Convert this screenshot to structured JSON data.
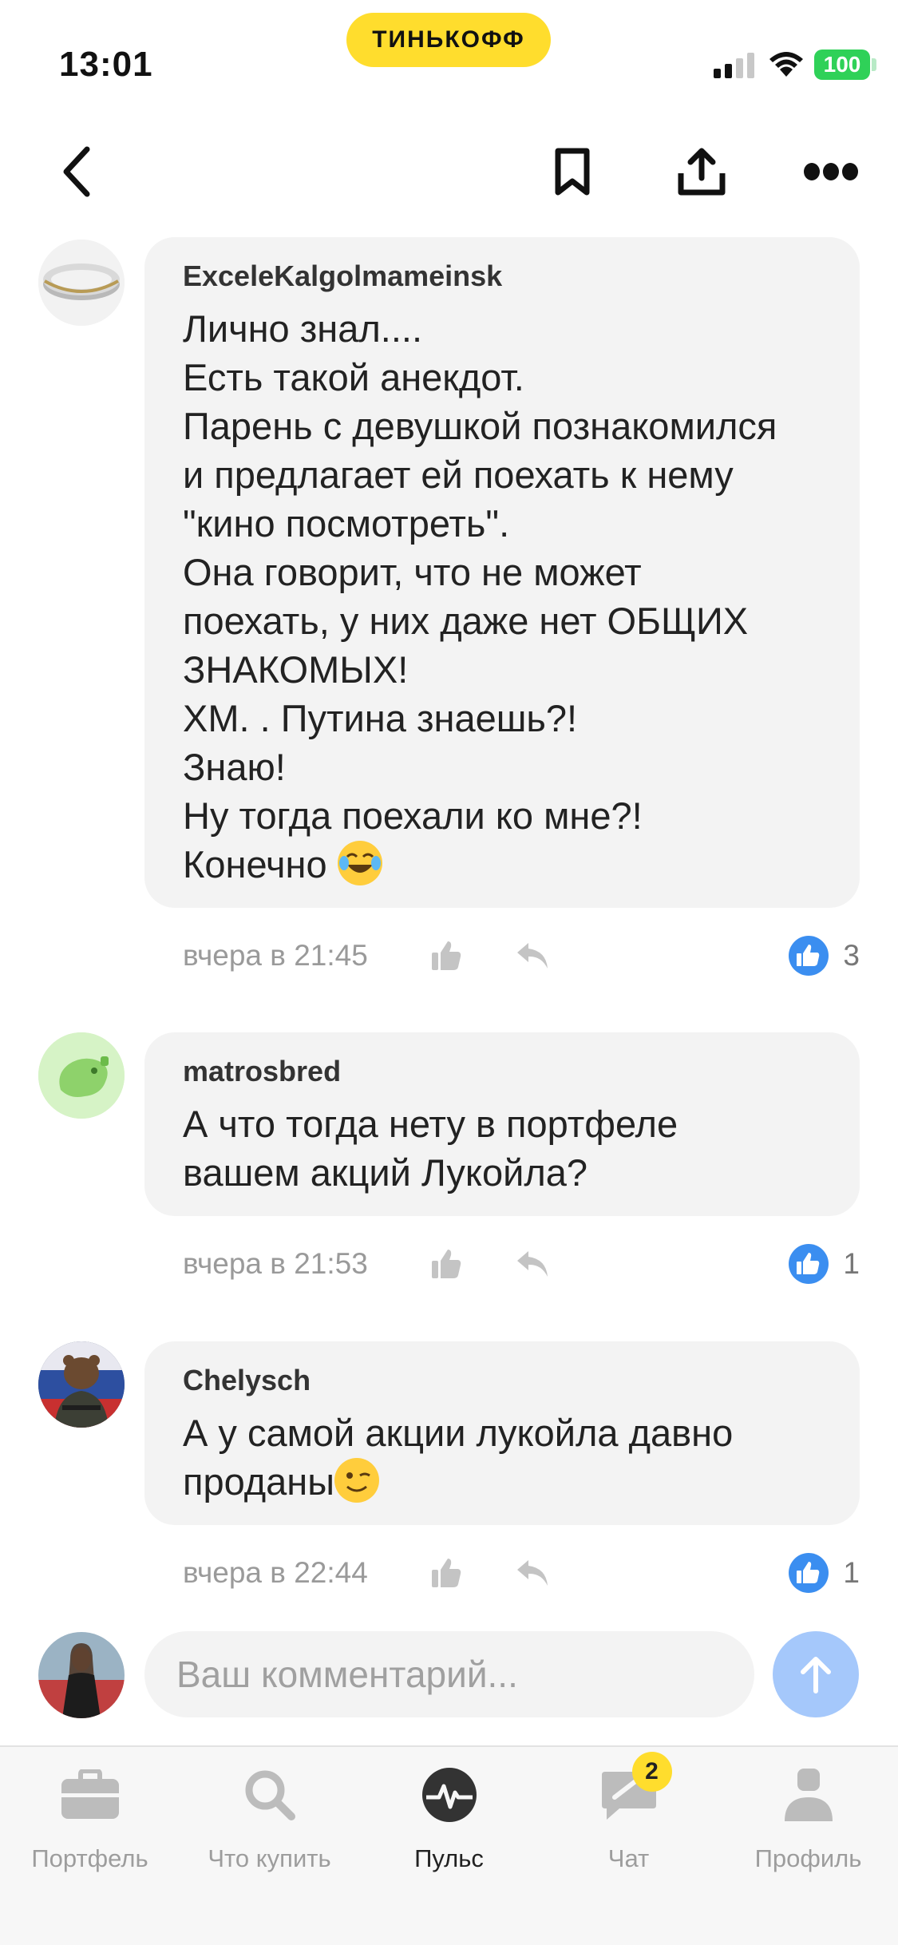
{
  "status_bar": {
    "time": "13:01",
    "brand": "ТИНЬКОФФ",
    "battery": "100",
    "battery_color": "#2fd158"
  },
  "nav": {
    "back_icon": "chevron-left-icon",
    "bookmark_icon": "bookmark-icon",
    "share_icon": "share-icon",
    "more_icon": "more-icon"
  },
  "comments": [
    {
      "author": "ExceleKalgolmameinsk",
      "text": "Лично знал....\nЕсть такой анекдот.\nПарень с девушкой познакомился\nи предлагает ей поехать к нему\n\"кино посмотреть\".\nОна говорит, что не может\nпоехать, у них даже нет ОБЩИХ\nЗНАКОМЫХ!\nХМ. . Путина знаешь?!\nЗнаю!\nНу тогда поехали ко мне?!\nКонечно",
      "emoji": "laughing-tears-emoji",
      "time": "вчера в 21:45",
      "likes": "3",
      "avatar": "ring-avatar"
    },
    {
      "author": "matrosbred",
      "text": "А что тогда нету в портфеле\nвашем акций Лукойла?",
      "emoji": "",
      "time": "вчера в 21:53",
      "likes": "1",
      "avatar": "capybara-avatar"
    },
    {
      "author": "Chelysch",
      "text": "А у самой акции лукойла давно\nпроданы",
      "emoji": "wink-emoji",
      "time": "вчера в 22:44",
      "likes": "1",
      "avatar": "bear-avatar"
    }
  ],
  "compose": {
    "placeholder": "Ваш комментарий..."
  },
  "tabs": [
    {
      "label": "Портфель",
      "icon": "briefcase-icon"
    },
    {
      "label": "Что купить",
      "icon": "search-icon"
    },
    {
      "label": "Пульс",
      "icon": "pulse-icon"
    },
    {
      "label": "Чат",
      "icon": "chat-icon",
      "badge": "2"
    },
    {
      "label": "Профиль",
      "icon": "profile-icon"
    }
  ],
  "colors": {
    "accent_yellow": "#ffdd2d",
    "like_blue": "#3b8ef0",
    "send_blue": "#a5c8fb"
  }
}
